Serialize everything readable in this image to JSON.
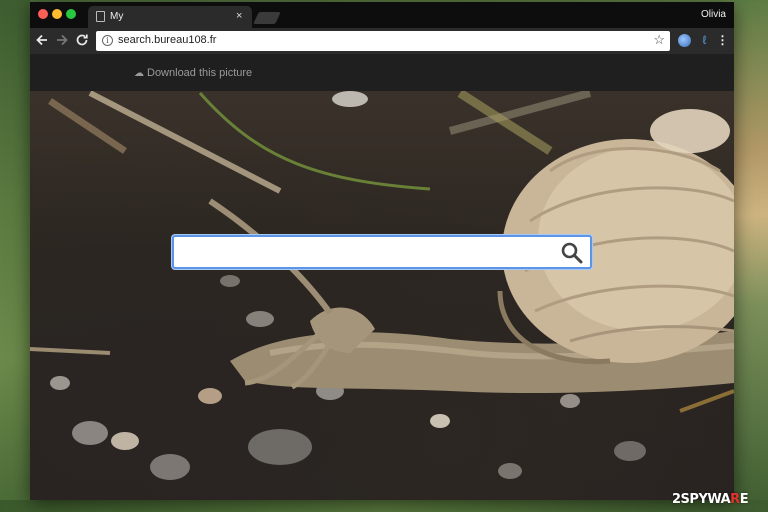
{
  "browser": {
    "tab_title": "My",
    "tab_close": "×",
    "profile_name": "Olivia",
    "url": "search.bureau108.fr"
  },
  "page": {
    "download_label": "Download this picture",
    "search": {
      "value": "",
      "placeholder": ""
    }
  },
  "watermark": {
    "prefix": "2",
    "main": "SPYWA",
    "accent": "R",
    "suffix": "E"
  },
  "icons": {
    "back": "arrow-left",
    "forward": "arrow-right",
    "reload": "reload",
    "info": "info",
    "star": "star",
    "menu": "kebab"
  },
  "colors": {
    "search_border": "#5d95e6",
    "chrome_dark": "#0d0d0d",
    "toolbar": "#2b2b2b",
    "watermark_accent": "#e5322d"
  }
}
